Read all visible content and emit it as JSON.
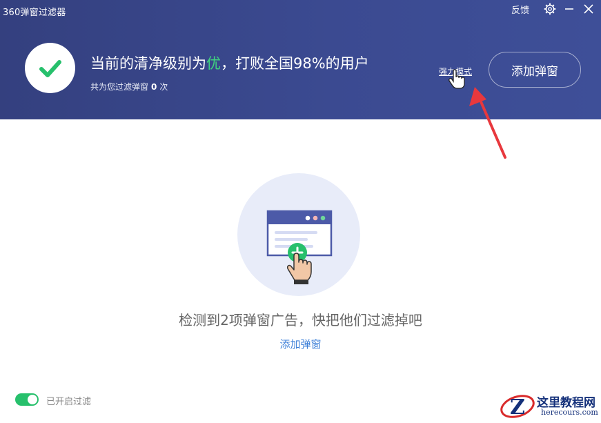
{
  "app": {
    "title": "360弹窗过滤器"
  },
  "window_controls": {
    "feedback_label": "反馈",
    "settings_icon": "gear-icon",
    "minimize_icon": "minimize-icon",
    "close_icon": "close-icon"
  },
  "status": {
    "prefix": "当前的清净级别为",
    "level": "优",
    "suffix": "，打败全国98%的用户",
    "sub_prefix": "共为您过滤弹窗",
    "filtered_count": "0",
    "sub_suffix": "次"
  },
  "actions": {
    "strong_mode_label": "强力模式",
    "add_popup_button": "添加弹窗"
  },
  "main": {
    "detect_text": "检测到2项弹窗广告，快把他们过滤掉吧",
    "add_popup_link": "添加弹窗"
  },
  "footer": {
    "toggle_label": "已开启过滤",
    "toggle_on": true
  },
  "watermark": {
    "line1": "这里教程网",
    "line2": "herecours.com"
  },
  "colors": {
    "header_bg": "#3b4a91",
    "accent_green": "#27c06c",
    "link_blue": "#3c7fd8",
    "arrow_red": "#e8383d"
  }
}
